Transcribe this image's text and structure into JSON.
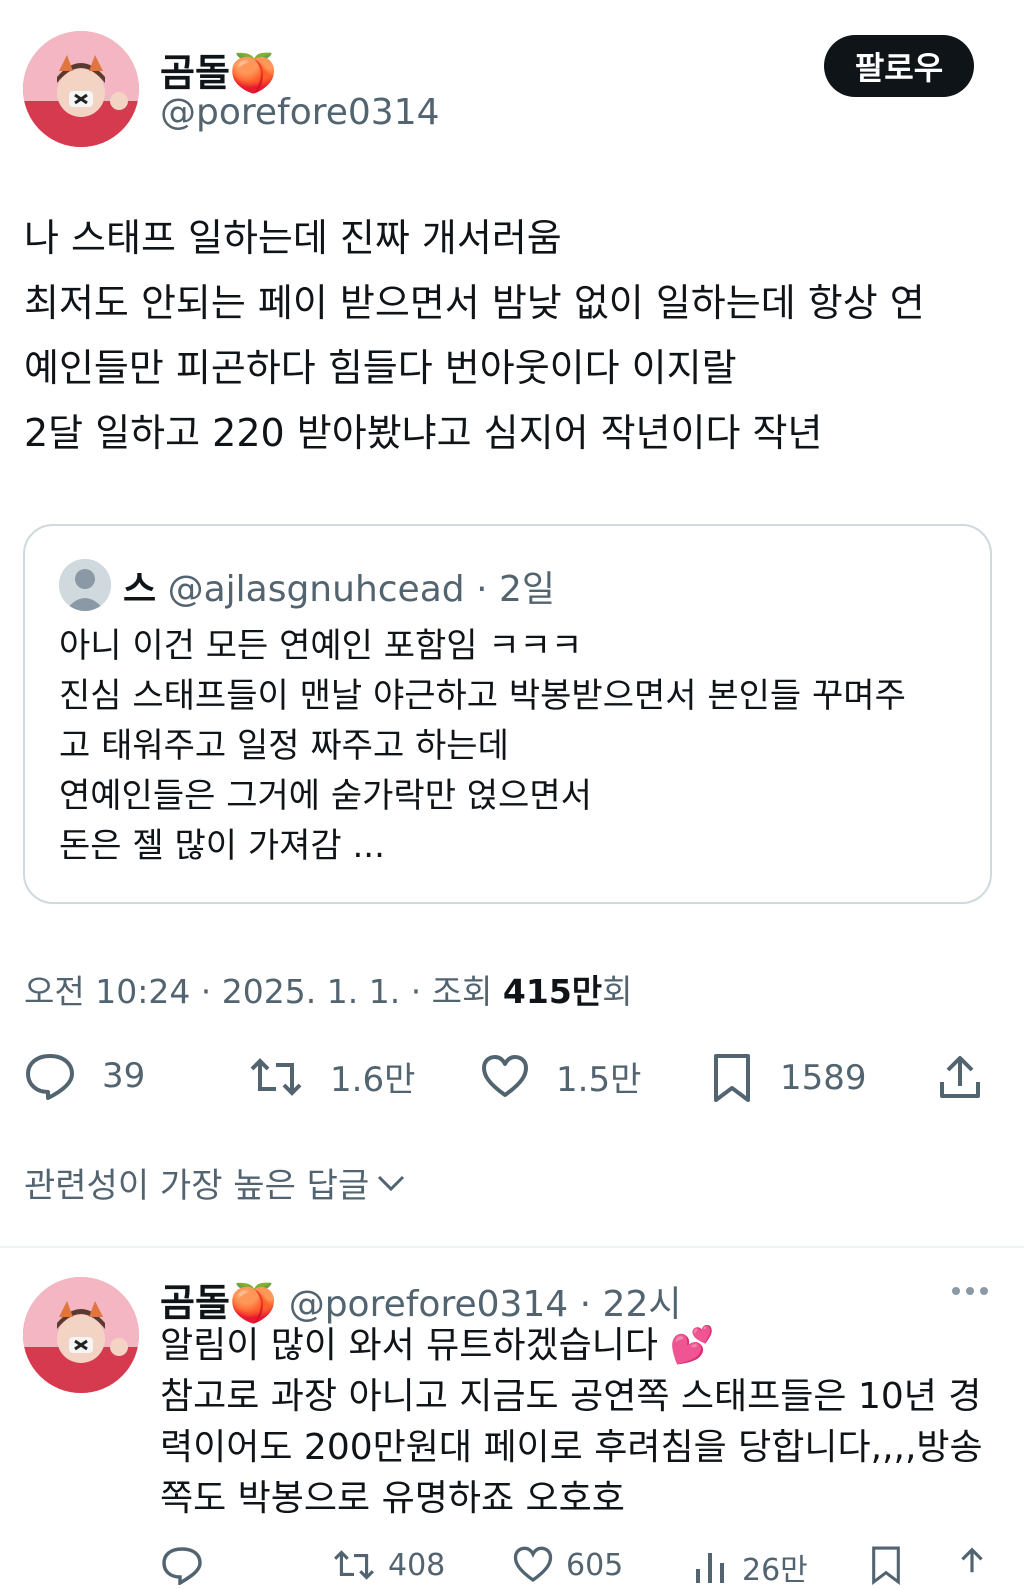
{
  "tweet": {
    "author_name": "곰돌",
    "author_emoji": "🍑",
    "author_handle": "@porefore0314",
    "follow_label": "팔로우",
    "text_lines": [
      "나 스태프 일하는데 진짜 개서러움",
      "최저도 안되는 페이 받으면서 밤낮 없이 일하는데 항상 연",
      "예인들만 피곤하다 힘들다 번아웃이다 이지랄",
      "2달 일하고 220 받아봤냐고 심지어 작년이다 작년"
    ],
    "quote": {
      "name": "스",
      "handle": "@ajlasgnuhcead",
      "time": "· 2일",
      "text_lines": [
        "아니 이건 모든 연예인 포함임 ㅋㅋㅋ",
        "진심 스태프들이 맨날 야근하고 박봉받으면서 본인들 꾸며주",
        "고 태워주고 일정 짜주고 하는데",
        "연예인들은 그거에 숟가락만 얹으면서",
        "돈은 젤 많이 가져감 ..."
      ]
    },
    "meta": {
      "time": "오전 10:24 · 2025. 1. 1. · 조회 ",
      "views": "415만",
      "views_suffix": "회"
    },
    "actions": {
      "replies": "39",
      "retweets": "1.6만",
      "likes": "1.5만",
      "bookmarks": "1589"
    }
  },
  "replies_sort_label": "관련성이 가장 높은 답글",
  "reply": {
    "author_name": "곰돌",
    "author_emoji": "🍑",
    "author_handle": "@porefore0314",
    "time": "· 22시",
    "text_lines": [
      "알림이 많이 와서 뮤트하겠습니다 💕",
      "참고로 과장 아니고 지금도 공연쪽 스태프들은 10년 경",
      "력이어도 200만원대 페이로 후려침을 당합니다,,,,방송",
      "쪽도 박봉으로 유명하죠 오호호"
    ],
    "actions": {
      "retweets": "408",
      "likes": "605",
      "views": "26만"
    }
  },
  "colors": {
    "text": "#0f1419",
    "secondary": "#536471",
    "border": "#cfd9de",
    "follow_bg": "#0f1419"
  }
}
